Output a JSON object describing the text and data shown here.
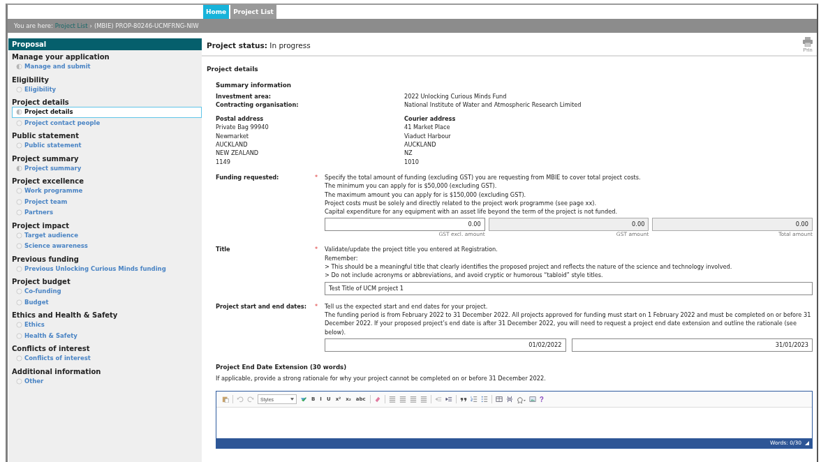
{
  "top_tabs": [
    {
      "label": "Home",
      "selected": true
    },
    {
      "label": "Project List",
      "selected": false
    }
  ],
  "breadcrumb": {
    "prefix": "You are here:",
    "link": "Project List",
    "separator": "›",
    "current": "(MBIE) PROP-80246-UCMFRNG-NIW"
  },
  "sidebar": {
    "title": "Proposal",
    "groups": [
      {
        "heading": "Manage your application",
        "items": [
          {
            "label": "Manage and submit",
            "started": true,
            "selected": false
          }
        ]
      },
      {
        "heading": "Eligibility",
        "items": [
          {
            "label": "Eligibility",
            "started": false,
            "selected": false
          }
        ]
      },
      {
        "heading": "Project details",
        "items": [
          {
            "label": "Project details",
            "started": true,
            "selected": true
          },
          {
            "label": "Project contact people",
            "started": false,
            "selected": false
          }
        ]
      },
      {
        "heading": "Public statement",
        "items": [
          {
            "label": "Public statement",
            "started": false,
            "selected": false
          }
        ]
      },
      {
        "heading": "Project summary",
        "items": [
          {
            "label": "Project summary",
            "started": true,
            "selected": false
          }
        ]
      },
      {
        "heading": "Project excellence",
        "items": [
          {
            "label": "Work programme",
            "started": false,
            "selected": false
          },
          {
            "label": "Project team",
            "started": false,
            "selected": false
          },
          {
            "label": "Partners",
            "started": false,
            "selected": false
          }
        ]
      },
      {
        "heading": "Project impact",
        "items": [
          {
            "label": "Target audience",
            "started": false,
            "selected": false
          },
          {
            "label": "Science awareness",
            "started": false,
            "selected": false
          }
        ]
      },
      {
        "heading": "Previous funding",
        "items": [
          {
            "label": "Previous Unlocking Curious Minds funding",
            "started": false,
            "selected": false
          }
        ]
      },
      {
        "heading": "Project budget",
        "items": [
          {
            "label": "Co-funding",
            "started": false,
            "selected": false
          },
          {
            "label": "Budget",
            "started": false,
            "selected": false
          }
        ]
      },
      {
        "heading": "Ethics and Health & Safety",
        "items": [
          {
            "label": "Ethics",
            "started": false,
            "selected": false
          },
          {
            "label": "Health & Safety",
            "started": false,
            "selected": false
          }
        ]
      },
      {
        "heading": "Conflicts of interest",
        "items": [
          {
            "label": "Conflicts of interest",
            "started": false,
            "selected": false
          }
        ]
      },
      {
        "heading": "Additional information",
        "items": [
          {
            "label": "Other",
            "started": false,
            "selected": false
          }
        ]
      }
    ]
  },
  "status": {
    "label": "Project status:",
    "value": "In progress"
  },
  "print": {
    "label": "Prin"
  },
  "section_title": "Project details",
  "summary": {
    "title": "Summary information",
    "fields": [
      {
        "label": "Investment area:",
        "value": "2022 Unlocking Curious Minds Fund"
      },
      {
        "label": "Contracting organisation:",
        "value": "National Institute of Water and Atmospheric Research Limited"
      }
    ],
    "postal": {
      "title": "Postal address",
      "lines": [
        "Private Bag 99940",
        "Newmarket",
        "AUCKLAND",
        "NEW ZEALAND",
        "1149"
      ]
    },
    "courier": {
      "title": "Courier address",
      "lines": [
        "41 Market Place",
        "Viaduct Harbour",
        "AUCKLAND",
        "NZ",
        "1010"
      ]
    }
  },
  "funding": {
    "label": "Funding requested:",
    "required_mark": "*",
    "help": [
      "Specify the total amount of funding (excluding GST) you are requesting from MBIE to cover total project costs.",
      "The minimum you can apply for is $50,000 (excluding GST).",
      "The maximum amount you can apply for is $150,000 (excluding GST).",
      "Project costs must be solely and directly related to the project work programme (see page xx).",
      "Capital expenditure for any equipment with an asset life beyond the term of the project is not funded."
    ],
    "amounts": [
      {
        "value": "0.00",
        "caption": "GST excl. amount",
        "disabled": false
      },
      {
        "value": "0.00",
        "caption": "GST amount",
        "disabled": true
      },
      {
        "value": "0.00",
        "caption": "Total amount",
        "disabled": true
      }
    ]
  },
  "title_field": {
    "label": "Title",
    "required_mark": "*",
    "help": [
      "Validate/update the project title you entered at Registration.",
      "Remember:",
      "> This should be a meaningful title that clearly identifies the proposed project and reflects the nature of the science and technology involved.",
      "> Do not include acronyms or abbreviations, and avoid cryptic or humorous “tabloid” style titles."
    ],
    "value": "Test Title of UCM project 1"
  },
  "dates": {
    "label": "Project start and end dates:",
    "required_mark": "*",
    "help": [
      "Tell us the expected start and end dates for your project.",
      "The funding period is from February 2022 to 31 December 2022. All projects approved for funding must start on 1 February 2022 and must be completed on or before 31 December 2022. If your proposed project’s end date is after 31 December 2022, you will need to request a project end date extension and outline the rationale (see below)."
    ],
    "start": "01/02/2022",
    "end": "31/01/2023"
  },
  "extension": {
    "title": "Project End Date Extension (30 words)",
    "help": "If applicable, provide a strong rationale for why your project cannot be completed on or before 31 December 2022.",
    "toolbar": {
      "styles": "Styles",
      "format_buttons": [
        "B",
        "I",
        "U",
        "x²",
        "x₂",
        "abc"
      ],
      "help": "?"
    },
    "word_count": "Words: 0/30"
  }
}
